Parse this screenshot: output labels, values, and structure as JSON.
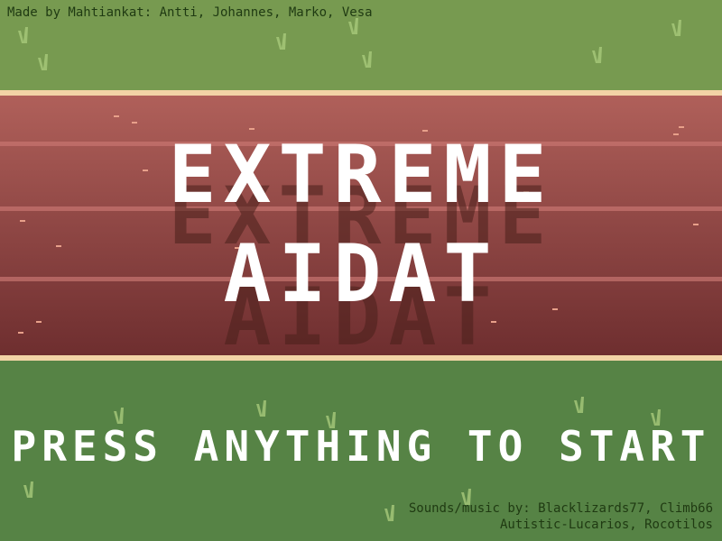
{
  "game": {
    "title_line1": "EXTREME",
    "title_line2": "AIDAT",
    "prompt": "PRESS ANYTHING TO START",
    "credits_top": "Made by Mahtiankat: Antti, Johannes, Marko, Vesa",
    "credits_bottom_line1": "Sounds/music by: Blacklizards77, Climb66",
    "credits_bottom_line2": "Autistic-Lucarios, Rocotilos"
  },
  "colors": {
    "grass_top": "#779a50",
    "grass_bottom": "#568345",
    "track_top": "#b0605a",
    "track_bottom": "#6e2e2f",
    "track_border": "#f2d3a6",
    "lane_line": "#c77570",
    "grass_blade": "#a8c97a",
    "title_text": "#ffffff",
    "title_shadow": "#4a201b"
  }
}
